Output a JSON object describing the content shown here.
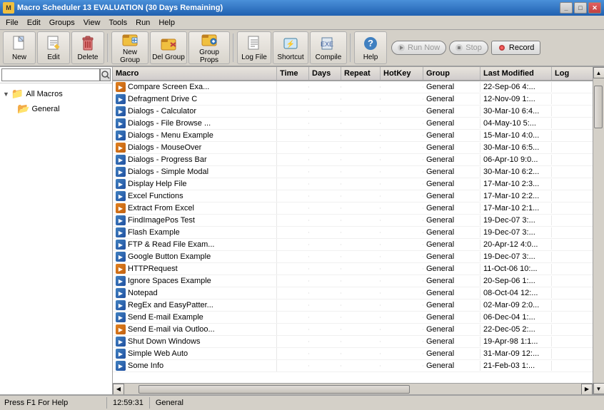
{
  "titlebar": {
    "title": "Macro Scheduler 13 EVALUATION (30 Days Remaining)",
    "controls": [
      "_",
      "□",
      "✕"
    ]
  },
  "menubar": {
    "items": [
      "File",
      "Edit",
      "Groups",
      "View",
      "Tools",
      "Run",
      "Help"
    ]
  },
  "toolbar": {
    "buttons": [
      {
        "label": "New",
        "icon": "📄"
      },
      {
        "label": "Edit",
        "icon": "✏️"
      },
      {
        "label": "Delete",
        "icon": "🗑️"
      },
      {
        "label": "New Group",
        "icon": "📁"
      },
      {
        "label": "Del Group",
        "icon": "📁"
      },
      {
        "label": "Group Props",
        "icon": "📁"
      },
      {
        "label": "Log File",
        "icon": "📋"
      },
      {
        "label": "Shortcut",
        "icon": "⚡"
      },
      {
        "label": "Compile",
        "icon": "🔧"
      },
      {
        "label": "Help",
        "icon": "❓"
      }
    ],
    "run_now": "Run Now",
    "stop": "Stop",
    "record": "Record"
  },
  "search": {
    "placeholder": ""
  },
  "tree": {
    "root": "All Macros",
    "children": [
      "General"
    ]
  },
  "columns": {
    "macro": "Macro",
    "time": "Time",
    "days": "Days",
    "repeat": "Repeat",
    "hotkey": "HotKey",
    "group": "Group",
    "lastmod": "Last Modified",
    "log": "Log"
  },
  "macros": [
    {
      "name": "Compare Screen Exa...",
      "time": "",
      "days": "",
      "repeat": "",
      "hotkey": "",
      "group": "General",
      "lastmod": "22-Sep-06 4:...",
      "log": ""
    },
    {
      "name": "Defragment Drive C",
      "time": "",
      "days": "",
      "repeat": "",
      "hotkey": "",
      "group": "General",
      "lastmod": "12-Nov-09 1:...",
      "log": ""
    },
    {
      "name": "Dialogs - Calculator",
      "time": "",
      "days": "",
      "repeat": "",
      "hotkey": "",
      "group": "General",
      "lastmod": "30-Mar-10 6:4...",
      "log": ""
    },
    {
      "name": "Dialogs - File Browse ...",
      "time": "",
      "days": "",
      "repeat": "",
      "hotkey": "",
      "group": "General",
      "lastmod": "04-May-10 5:...",
      "log": ""
    },
    {
      "name": "Dialogs - Menu Example",
      "time": "",
      "days": "",
      "repeat": "",
      "hotkey": "",
      "group": "General",
      "lastmod": "15-Mar-10 4:0...",
      "log": ""
    },
    {
      "name": "Dialogs - MouseOver",
      "time": "",
      "days": "",
      "repeat": "",
      "hotkey": "",
      "group": "General",
      "lastmod": "30-Mar-10 6:5...",
      "log": ""
    },
    {
      "name": "Dialogs - Progress Bar",
      "time": "",
      "days": "",
      "repeat": "",
      "hotkey": "",
      "group": "General",
      "lastmod": "06-Apr-10 9:0...",
      "log": ""
    },
    {
      "name": "Dialogs - Simple Modal",
      "time": "",
      "days": "",
      "repeat": "",
      "hotkey": "",
      "group": "General",
      "lastmod": "30-Mar-10 6:2...",
      "log": ""
    },
    {
      "name": "Display Help File",
      "time": "",
      "days": "",
      "repeat": "",
      "hotkey": "",
      "group": "General",
      "lastmod": "17-Mar-10 2:3...",
      "log": ""
    },
    {
      "name": "Excel Functions",
      "time": "",
      "days": "",
      "repeat": "",
      "hotkey": "",
      "group": "General",
      "lastmod": "17-Mar-10 2:2...",
      "log": ""
    },
    {
      "name": "Extract From Excel",
      "time": "",
      "days": "",
      "repeat": "",
      "hotkey": "",
      "group": "General",
      "lastmod": "17-Mar-10 2:1...",
      "log": ""
    },
    {
      "name": "FindImagePos Test",
      "time": "",
      "days": "",
      "repeat": "",
      "hotkey": "",
      "group": "General",
      "lastmod": "19-Dec-07 3:...",
      "log": ""
    },
    {
      "name": "Flash Example",
      "time": "",
      "days": "",
      "repeat": "",
      "hotkey": "",
      "group": "General",
      "lastmod": "19-Dec-07 3:...",
      "log": ""
    },
    {
      "name": "FTP & Read File Exam...",
      "time": "",
      "days": "",
      "repeat": "",
      "hotkey": "",
      "group": "General",
      "lastmod": "20-Apr-12 4:0...",
      "log": ""
    },
    {
      "name": "Google Button Example",
      "time": "",
      "days": "",
      "repeat": "",
      "hotkey": "",
      "group": "General",
      "lastmod": "19-Dec-07 3:...",
      "log": ""
    },
    {
      "name": "HTTPRequest",
      "time": "",
      "days": "",
      "repeat": "",
      "hotkey": "",
      "group": "General",
      "lastmod": "11-Oct-06 10:...",
      "log": ""
    },
    {
      "name": "Ignore Spaces Example",
      "time": "",
      "days": "",
      "repeat": "",
      "hotkey": "",
      "group": "General",
      "lastmod": "20-Sep-06 1:...",
      "log": ""
    },
    {
      "name": "Notepad",
      "time": "",
      "days": "",
      "repeat": "",
      "hotkey": "",
      "group": "General",
      "lastmod": "08-Oct-04 12:...",
      "log": ""
    },
    {
      "name": "RegEx and EasyPatter...",
      "time": "",
      "days": "",
      "repeat": "",
      "hotkey": "",
      "group": "General",
      "lastmod": "02-Mar-09 2:0...",
      "log": ""
    },
    {
      "name": "Send E-mail Example",
      "time": "",
      "days": "",
      "repeat": "",
      "hotkey": "",
      "group": "General",
      "lastmod": "06-Dec-04 1:...",
      "log": ""
    },
    {
      "name": "Send E-mail via Outloo...",
      "time": "",
      "days": "",
      "repeat": "",
      "hotkey": "",
      "group": "General",
      "lastmod": "22-Dec-05 2:...",
      "log": ""
    },
    {
      "name": "Shut Down Windows",
      "time": "",
      "days": "",
      "repeat": "",
      "hotkey": "",
      "group": "General",
      "lastmod": "19-Apr-98 1:1...",
      "log": ""
    },
    {
      "name": "Simple Web Auto",
      "time": "",
      "days": "",
      "repeat": "",
      "hotkey": "",
      "group": "General",
      "lastmod": "31-Mar-09 12:...",
      "log": ""
    },
    {
      "name": "Some Info",
      "time": "",
      "days": "",
      "repeat": "",
      "hotkey": "",
      "group": "General",
      "lastmod": "21-Feb-03 1:...",
      "log": ""
    }
  ],
  "statusbar": {
    "help": "Press F1 For Help",
    "time": "12:59:31",
    "group": "General"
  }
}
